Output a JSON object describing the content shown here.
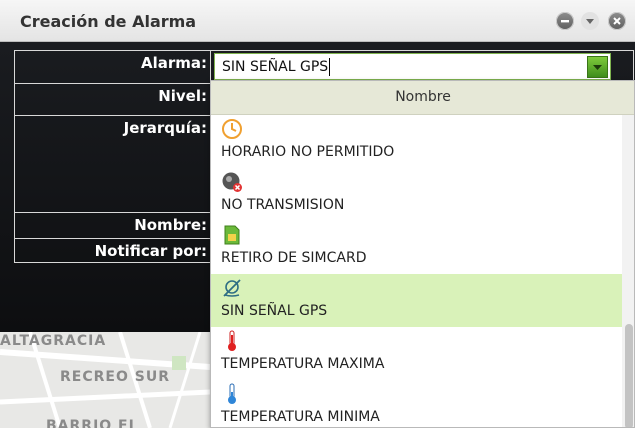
{
  "window": {
    "title": "Creación de Alarma",
    "controls": [
      "minimize-icon",
      "menu-icon",
      "close-icon"
    ]
  },
  "form": {
    "labels": {
      "alarma": "Alarma:",
      "nivel": "Nivel:",
      "jerarquia": "Jerarquía:",
      "nombre": "Nombre:",
      "notificar": "Notificar por:"
    },
    "alarma_value": "SIN SEÑAL GPS"
  },
  "dropdown": {
    "header": "Nombre",
    "options": [
      {
        "label": "HORARIO NO PERMITIDO",
        "icon": "clock-icon"
      },
      {
        "label": "NO TRANSMISION",
        "icon": "no-signal-icon"
      },
      {
        "label": "RETIRO DE SIMCARD",
        "icon": "simcard-icon"
      },
      {
        "label": "SIN SEÑAL GPS",
        "icon": "gps-off-icon",
        "selected": true
      },
      {
        "label": "TEMPERATURA MAXIMA",
        "icon": "thermometer-hot-icon"
      },
      {
        "label": "TEMPERATURA MINIMA",
        "icon": "thermometer-cold-icon"
      }
    ]
  },
  "map": {
    "labels": [
      "ALTAGRACIA",
      "RECREO SUR",
      "BARRIO EL"
    ]
  },
  "colors": {
    "accent_green": "#5aa529",
    "selected_row": "#d9f2b9",
    "header_bg": "#e6e8d7"
  }
}
